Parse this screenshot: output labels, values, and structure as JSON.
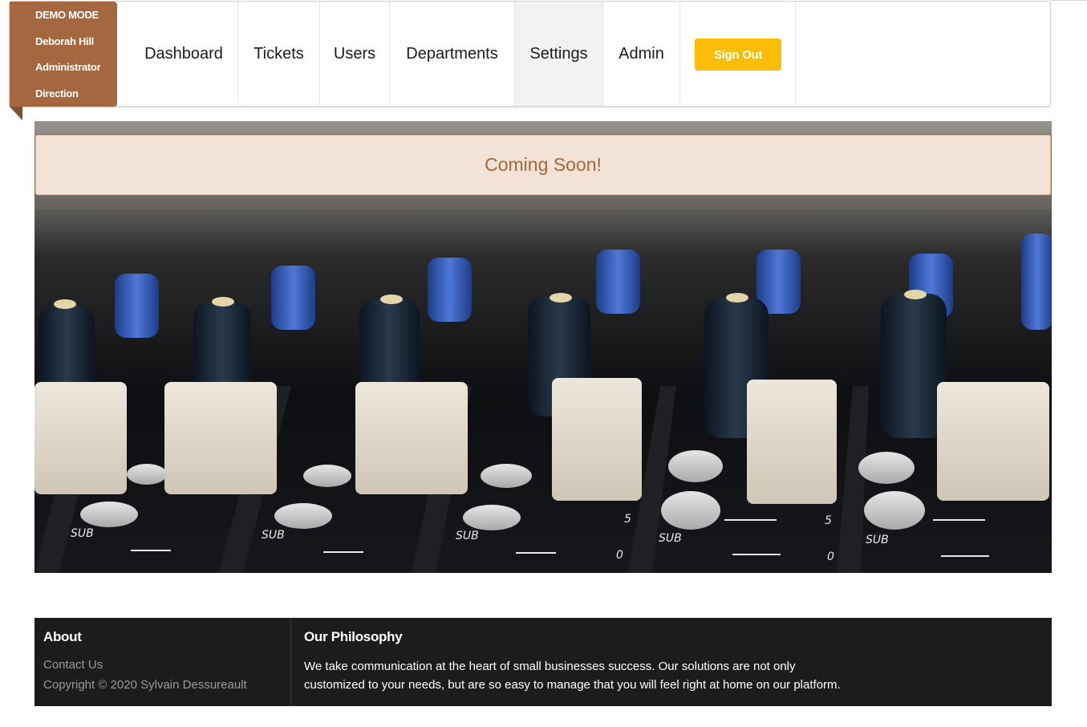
{
  "ribbon": {
    "mode": "DEMO MODE",
    "user": "Deborah Hill",
    "role": "Administrator",
    "department": "Direction"
  },
  "nav": {
    "items": [
      {
        "label": "Dashboard"
      },
      {
        "label": "Tickets"
      },
      {
        "label": "Users"
      },
      {
        "label": "Departments"
      },
      {
        "label": "Settings",
        "active": true
      },
      {
        "label": "Admin"
      }
    ],
    "signout_label": "Sign Out"
  },
  "banner": {
    "message": "Coming Soon!"
  },
  "hero": {
    "fader_labels": [
      "SUB",
      "SUB",
      "SUB",
      "SUB",
      "SUB"
    ],
    "scale_labels": [
      "5",
      "0"
    ]
  },
  "footer": {
    "about_title": "About",
    "contact_label": "Contact Us",
    "copyright": "Copyright © 2020 Sylvain Dessureault",
    "philosophy_title": "Our Philosophy",
    "philosophy_line1": "We take communication at the heart of small businesses success. Our solutions are not only",
    "philosophy_line2": "customized to your needs, but are so easy to manage that you will feel right at home on our platform."
  },
  "colors": {
    "ribbon": "#a5673f",
    "signout": "#fbbd08",
    "banner_bg": "#f3e2d6",
    "footer_bg": "#1b1c1d"
  }
}
